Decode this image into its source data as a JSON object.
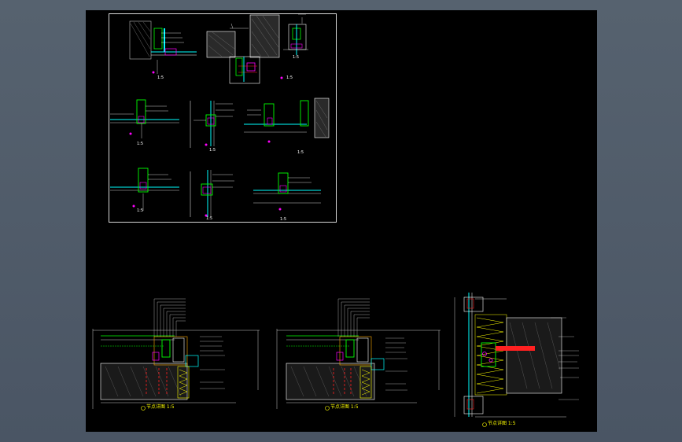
{
  "app": {
    "background": "#000000",
    "chrome_color": "#4e5a6b",
    "sheet_border_color": "#d8d8d8"
  },
  "colors": {
    "glass": "#00ffff",
    "frame": "#00ff00",
    "dimension": "#ffffff",
    "section_cut": "#ff00ff",
    "anchor": "#ff2020",
    "insulation": "#ffff00",
    "leader": "#d0d0d0"
  },
  "top_sheet": {
    "details": [
      {
        "caption": "1:5"
      },
      {
        "caption": "1:5"
      },
      {
        "caption": "1:5"
      },
      {
        "caption": "1:5"
      },
      {
        "caption": "1:5"
      },
      {
        "caption": "1:5"
      },
      {
        "caption": "1:5"
      },
      {
        "caption": "1:5"
      },
      {
        "caption": "1:5"
      }
    ]
  },
  "bottom_sections": [
    {
      "caption": "节点详图 1:5"
    },
    {
      "caption": "节点详图 1:5"
    },
    {
      "caption": "节点详图 1:5"
    }
  ]
}
